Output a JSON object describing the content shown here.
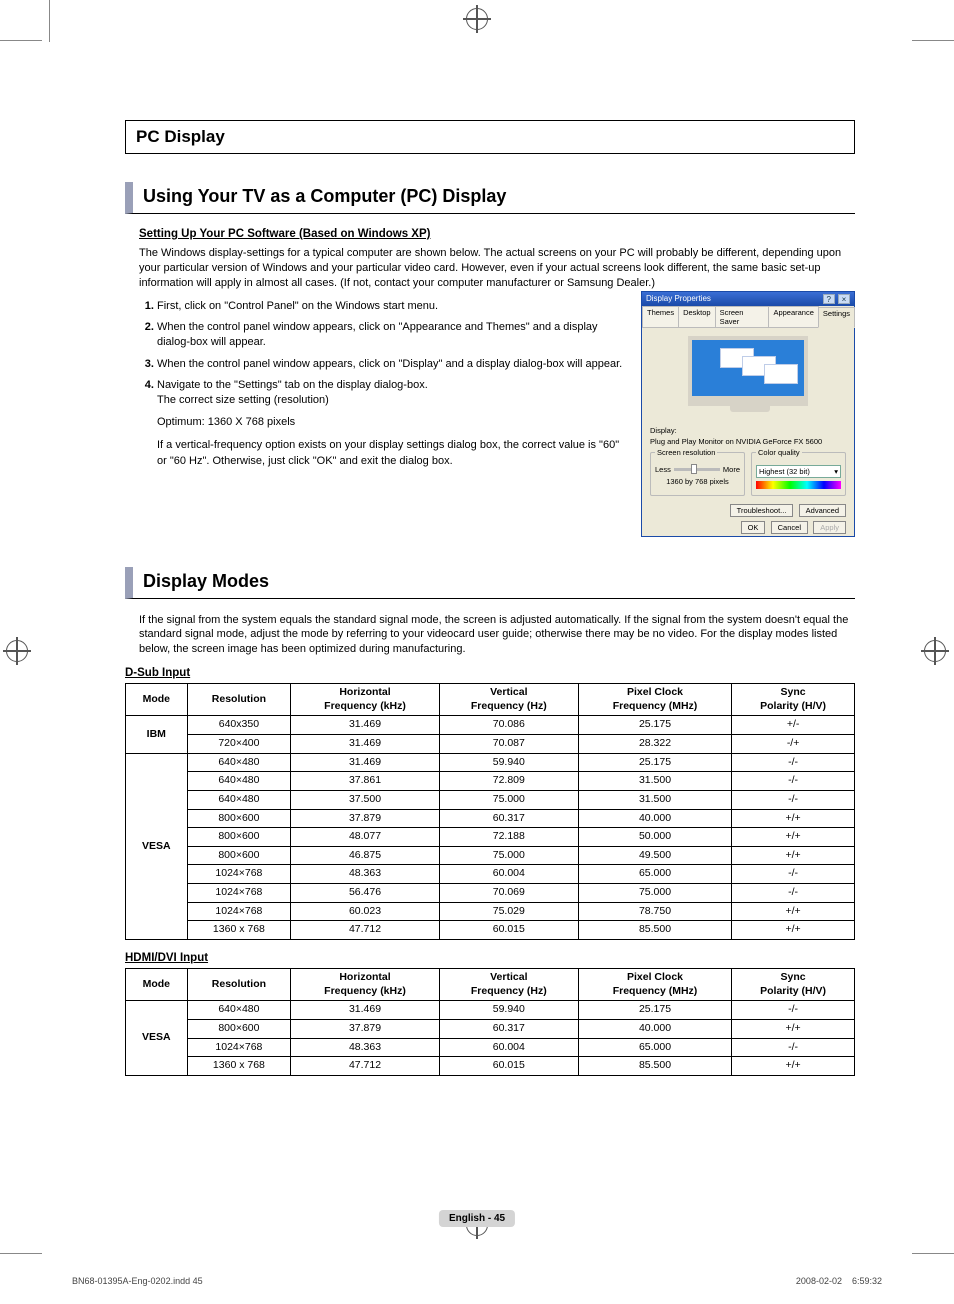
{
  "title_box": "PC Display",
  "sections": {
    "using": {
      "heading": "Using Your TV as a Computer (PC) Display",
      "subheading": "Setting Up Your PC Software (Based on Windows XP)",
      "intro": "The Windows display-settings for a typical computer are shown below. The actual screens on your PC will probably be different, depending upon your particular version of Windows and your particular video card. However, even if your actual screens look different, the same basic set-up information will apply in almost all cases. (If not, contact your computer manufacturer or Samsung Dealer.)",
      "steps": [
        "First, click on \"Control Panel\" on the Windows start menu.",
        "When the control panel window appears, click on \"Appearance and Themes\" and a display dialog-box will appear.",
        "When the control panel window appears, click on \"Display\" and a display dialog-box will appear.",
        "Navigate to the \"Settings\" tab on the display dialog-box."
      ],
      "step4_sub1": "The correct size setting (resolution)",
      "step4_sub2": "Optimum: 1360 X 768 pixels",
      "step4_sub3": "If a vertical-frequency option exists on your display settings dialog box, the correct value is \"60\" or \"60 Hz\". Otherwise, just click \"OK\" and exit the dialog box."
    },
    "display_modes": {
      "heading": "Display Modes",
      "intro": "If the signal from the system equals the standard signal mode, the screen is adjusted automatically.  If the signal from the system doesn't equal the standard signal mode, adjust the mode by referring to your videocard user guide; otherwise there may be no video. For the display modes listed below, the screen image has been optimized during manufacturing."
    }
  },
  "dialog": {
    "title": "Display Properties",
    "tabs": [
      "Themes",
      "Desktop",
      "Screen Saver",
      "Appearance",
      "Settings"
    ],
    "active_tab": 4,
    "display_label": "Display:",
    "display_value": "Plug and Play Monitor on NVIDIA GeForce FX 5600",
    "res_group": "Screen resolution",
    "res_less": "Less",
    "res_more": "More",
    "res_value": "1360 by 768 pixels",
    "cq_group": "Color quality",
    "cq_value": "Highest (32 bit)",
    "btn_troubleshoot": "Troubleshoot...",
    "btn_advanced": "Advanced",
    "btn_ok": "OK",
    "btn_cancel": "Cancel",
    "btn_apply": "Apply"
  },
  "table_headers": [
    "Mode",
    "Resolution",
    "Horizontal Frequency (kHz)",
    "Vertical Frequency (Hz)",
    "Pixel Clock Frequency (MHz)",
    "Sync Polarity (H/V)"
  ],
  "dsub": {
    "label": "D-Sub Input",
    "groups": [
      {
        "mode": "IBM",
        "rows": [
          [
            "640x350",
            "31.469",
            "70.086",
            "25.175",
            "+/-"
          ],
          [
            "720×400",
            "31.469",
            "70.087",
            "28.322",
            "-/+"
          ]
        ]
      },
      {
        "mode": "VESA",
        "rows": [
          [
            "640×480",
            "31.469",
            "59.940",
            "25.175",
            "-/-"
          ],
          [
            "640×480",
            "37.861",
            "72.809",
            "31.500",
            "-/-"
          ],
          [
            "640×480",
            "37.500",
            "75.000",
            "31.500",
            "-/-"
          ],
          [
            "800×600",
            "37.879",
            "60.317",
            "40.000",
            "+/+"
          ],
          [
            "800×600",
            "48.077",
            "72.188",
            "50.000",
            "+/+"
          ],
          [
            "800×600",
            "46.875",
            "75.000",
            "49.500",
            "+/+"
          ],
          [
            "1024×768",
            "48.363",
            "60.004",
            "65.000",
            "-/-"
          ],
          [
            "1024×768",
            "56.476",
            "70.069",
            "75.000",
            "-/-"
          ],
          [
            "1024×768",
            "60.023",
            "75.029",
            "78.750",
            "+/+"
          ],
          [
            "1360 x 768",
            "47.712",
            "60.015",
            "85.500",
            "+/+"
          ]
        ]
      }
    ]
  },
  "hdmi": {
    "label": "HDMI/DVI Input",
    "groups": [
      {
        "mode": "VESA",
        "rows": [
          [
            "640×480",
            "31.469",
            "59.940",
            "25.175",
            "-/-"
          ],
          [
            "800×600",
            "37.879",
            "60.317",
            "40.000",
            "+/+"
          ],
          [
            "1024×768",
            "48.363",
            "60.004",
            "65.000",
            "-/-"
          ],
          [
            "1360 x 768",
            "47.712",
            "60.015",
            "85.500",
            "+/+"
          ]
        ]
      }
    ]
  },
  "footer": {
    "page": "English - 45",
    "left": "BN68-01395A-Eng-0202.indd   45",
    "right": "2008-02-02      6:59:32"
  }
}
